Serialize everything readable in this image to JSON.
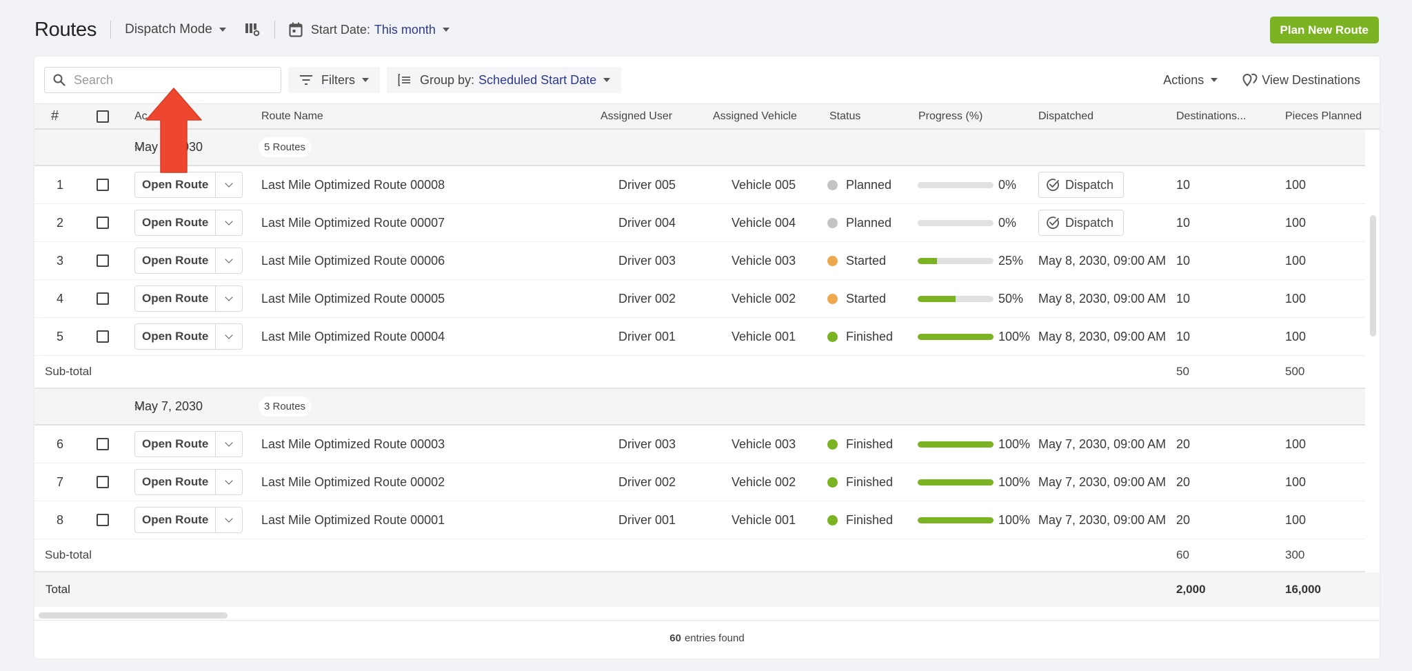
{
  "header": {
    "title": "Routes",
    "mode_label": "Dispatch Mode",
    "date_filter_label": "Start Date:",
    "date_filter_value": "This month",
    "plan_button": "Plan New Route"
  },
  "toolbar": {
    "search_placeholder": "Search",
    "search_value": "",
    "filters_label": "Filters",
    "groupby_label": "Group by:",
    "groupby_value": "Scheduled Start Date",
    "actions_label": "Actions",
    "view_destinations_label": "View Destinations"
  },
  "colors": {
    "accent_green": "#7cb322",
    "accent_blue": "#2b3a8c",
    "status_planned": "#c4c4c4",
    "status_started": "#eda84e",
    "status_finished": "#7cb322",
    "annotation_arrow": "#ee4730"
  },
  "table": {
    "columns": {
      "num": "#",
      "action": "Ac",
      "route_name": "Route Name",
      "assigned_user": "Assigned User",
      "assigned_vehicle": "Assigned Vehicle",
      "status": "Status",
      "progress": "Progress (%)",
      "dispatched": "Dispatched",
      "destinations": "Destinations...",
      "pieces_planned": "Pieces Planned"
    },
    "open_route_label": "Open Route",
    "dispatch_label": "Dispatch",
    "subtotal_label": "Sub-total",
    "total_label": "Total",
    "groups": [
      {
        "date": "May 8, 2030",
        "count": "5 Routes",
        "rows": [
          {
            "num": "1",
            "name": "Last Mile Optimized Route 00008",
            "user": "Driver 005",
            "vehicle": "Vehicle 005",
            "status": "Planned",
            "progress": 0,
            "progress_label": "0%",
            "dispatched": "",
            "destinations": "10",
            "pieces": "100"
          },
          {
            "num": "2",
            "name": "Last Mile Optimized Route 00007",
            "user": "Driver 004",
            "vehicle": "Vehicle 004",
            "status": "Planned",
            "progress": 0,
            "progress_label": "0%",
            "dispatched": "",
            "destinations": "10",
            "pieces": "100"
          },
          {
            "num": "3",
            "name": "Last Mile Optimized Route 00006",
            "user": "Driver 003",
            "vehicle": "Vehicle 003",
            "status": "Started",
            "progress": 25,
            "progress_label": "25%",
            "dispatched": "May 8, 2030, 09:00 AM",
            "destinations": "10",
            "pieces": "100"
          },
          {
            "num": "4",
            "name": "Last Mile Optimized Route 00005",
            "user": "Driver 002",
            "vehicle": "Vehicle 002",
            "status": "Started",
            "progress": 50,
            "progress_label": "50%",
            "dispatched": "May 8, 2030, 09:00 AM",
            "destinations": "10",
            "pieces": "100"
          },
          {
            "num": "5",
            "name": "Last Mile Optimized Route 00004",
            "user": "Driver 001",
            "vehicle": "Vehicle 001",
            "status": "Finished",
            "progress": 100,
            "progress_label": "100%",
            "dispatched": "May 8, 2030, 09:00 AM",
            "destinations": "10",
            "pieces": "100"
          }
        ],
        "subtotal": {
          "destinations": "50",
          "pieces": "500"
        }
      },
      {
        "date": "May 7, 2030",
        "count": "3 Routes",
        "rows": [
          {
            "num": "6",
            "name": "Last Mile Optimized Route 00003",
            "user": "Driver 003",
            "vehicle": "Vehicle 003",
            "status": "Finished",
            "progress": 100,
            "progress_label": "100%",
            "dispatched": "May 7, 2030, 09:00 AM",
            "destinations": "20",
            "pieces": "100"
          },
          {
            "num": "7",
            "name": "Last Mile Optimized Route 00002",
            "user": "Driver 002",
            "vehicle": "Vehicle 002",
            "status": "Finished",
            "progress": 100,
            "progress_label": "100%",
            "dispatched": "May 7, 2030, 09:00 AM",
            "destinations": "20",
            "pieces": "100"
          },
          {
            "num": "8",
            "name": "Last Mile Optimized Route 00001",
            "user": "Driver 001",
            "vehicle": "Vehicle 001",
            "status": "Finished",
            "progress": 100,
            "progress_label": "100%",
            "dispatched": "May 7, 2030, 09:00 AM",
            "destinations": "20",
            "pieces": "100"
          }
        ],
        "subtotal": {
          "destinations": "60",
          "pieces": "300"
        }
      }
    ],
    "total": {
      "destinations": "2,000",
      "pieces": "16,000"
    }
  },
  "footer": {
    "count": "60",
    "label": "entries found"
  }
}
